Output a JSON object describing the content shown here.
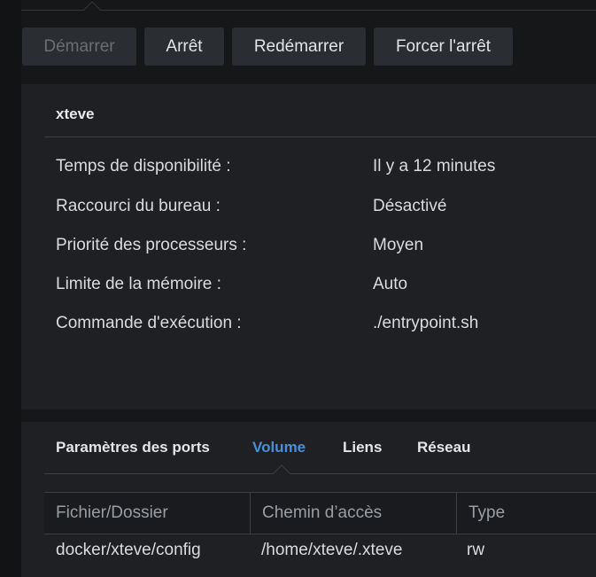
{
  "toolbar": {
    "start_label": "Démarrer",
    "stop_label": "Arrêt",
    "restart_label": "Redémarrer",
    "force_stop_label": "Forcer l'arrêt"
  },
  "container": {
    "name": "xteve",
    "details": [
      {
        "label": "Temps de disponibilité :",
        "value": "Il y a 12 minutes"
      },
      {
        "label": "Raccourci du bureau :",
        "value": "Désactivé"
      },
      {
        "label": "Priorité des processeurs :",
        "value": "Moyen"
      },
      {
        "label": "Limite de la mémoire :",
        "value": "Auto"
      },
      {
        "label": "Commande d'exécution :",
        "value": "./entrypoint.sh"
      }
    ]
  },
  "tabs": [
    {
      "label": "Paramètres des ports",
      "active": false
    },
    {
      "label": "Volume",
      "active": true
    },
    {
      "label": "Liens",
      "active": false
    },
    {
      "label": "Réseau",
      "active": false
    }
  ],
  "volume_table": {
    "columns": [
      "Fichier/Dossier",
      "Chemin d’accès",
      "Type"
    ],
    "rows": [
      [
        "docker/xteve/config",
        "/home/xteve/.xteve",
        "rw"
      ]
    ]
  },
  "colors": {
    "background": "#161719",
    "panel": "#1e2023",
    "button": "#2a2d31",
    "accent": "#4a90d9"
  }
}
